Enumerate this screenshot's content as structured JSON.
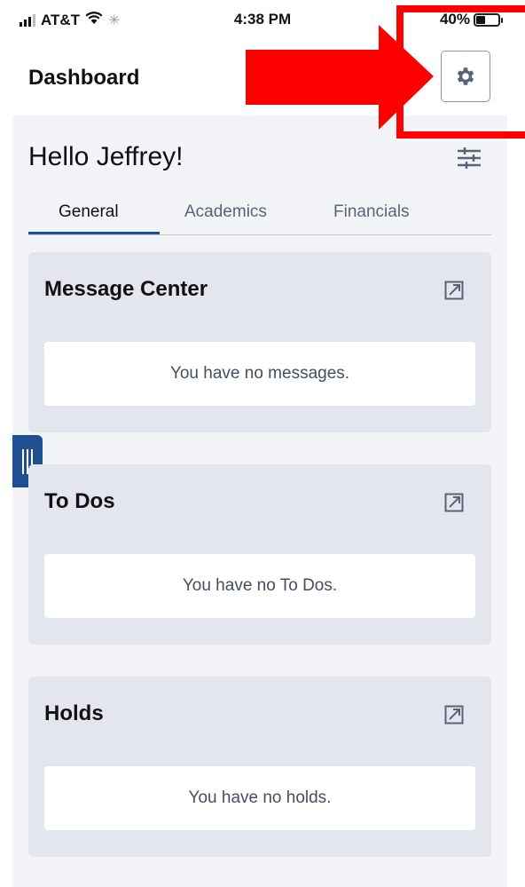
{
  "status_bar": {
    "carrier": "AT&T",
    "time": "4:38 PM",
    "battery": "40%"
  },
  "header": {
    "title": "Dashboard"
  },
  "greeting": "Hello Jeffrey!",
  "tabs": [
    {
      "label": "General",
      "active": true
    },
    {
      "label": "Academics",
      "active": false
    },
    {
      "label": "Financials",
      "active": false
    }
  ],
  "cards": [
    {
      "title": "Message Center",
      "body": "You have no messages."
    },
    {
      "title": "To Dos",
      "body": "You have no To Dos."
    },
    {
      "title": "Holds",
      "body": "You have no holds."
    }
  ],
  "colors": {
    "accent": "#1d4f91",
    "annotation": "#ff0000",
    "card_bg": "#e4e6ef",
    "page_bg": "#f3f4f8"
  },
  "icons": [
    "gear-icon",
    "filter-sliders-icon",
    "external-link-icon",
    "drawer-handle-icon"
  ]
}
